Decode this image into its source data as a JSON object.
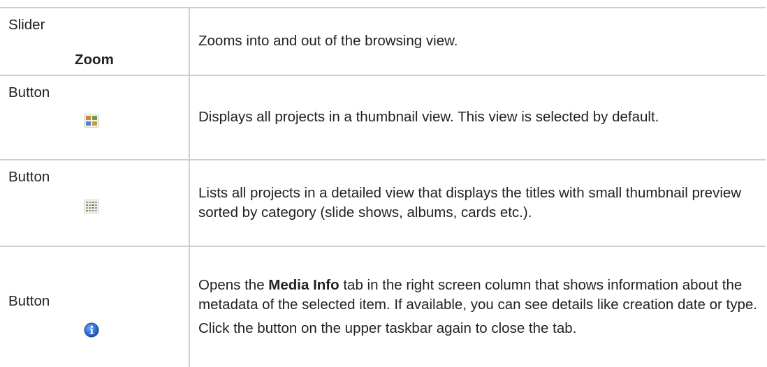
{
  "rows": [
    {
      "type": "Slider",
      "control_label": "Zoom",
      "description": "Zooms into and out of the browsing view."
    },
    {
      "type": "Button",
      "icon": "thumbnail-view-icon",
      "description": "Displays all projects in a thumbnail view. This view is selected by default."
    },
    {
      "type": "Button",
      "icon": "detail-list-view-icon",
      "description": "Lists all projects in a detailed view that displays the titles with small thumbnail preview sorted by category (slide shows, albums, cards etc.)."
    },
    {
      "type": "Button",
      "icon": "info-icon",
      "description_prefix": "Opens the ",
      "description_bold": "Media Info",
      "description_suffix": " tab in the right screen column that shows information about the metadata of the selected item. If available, you can see details like creation date or type.",
      "note": "Click the button on the upper taskbar again to close the tab."
    }
  ]
}
